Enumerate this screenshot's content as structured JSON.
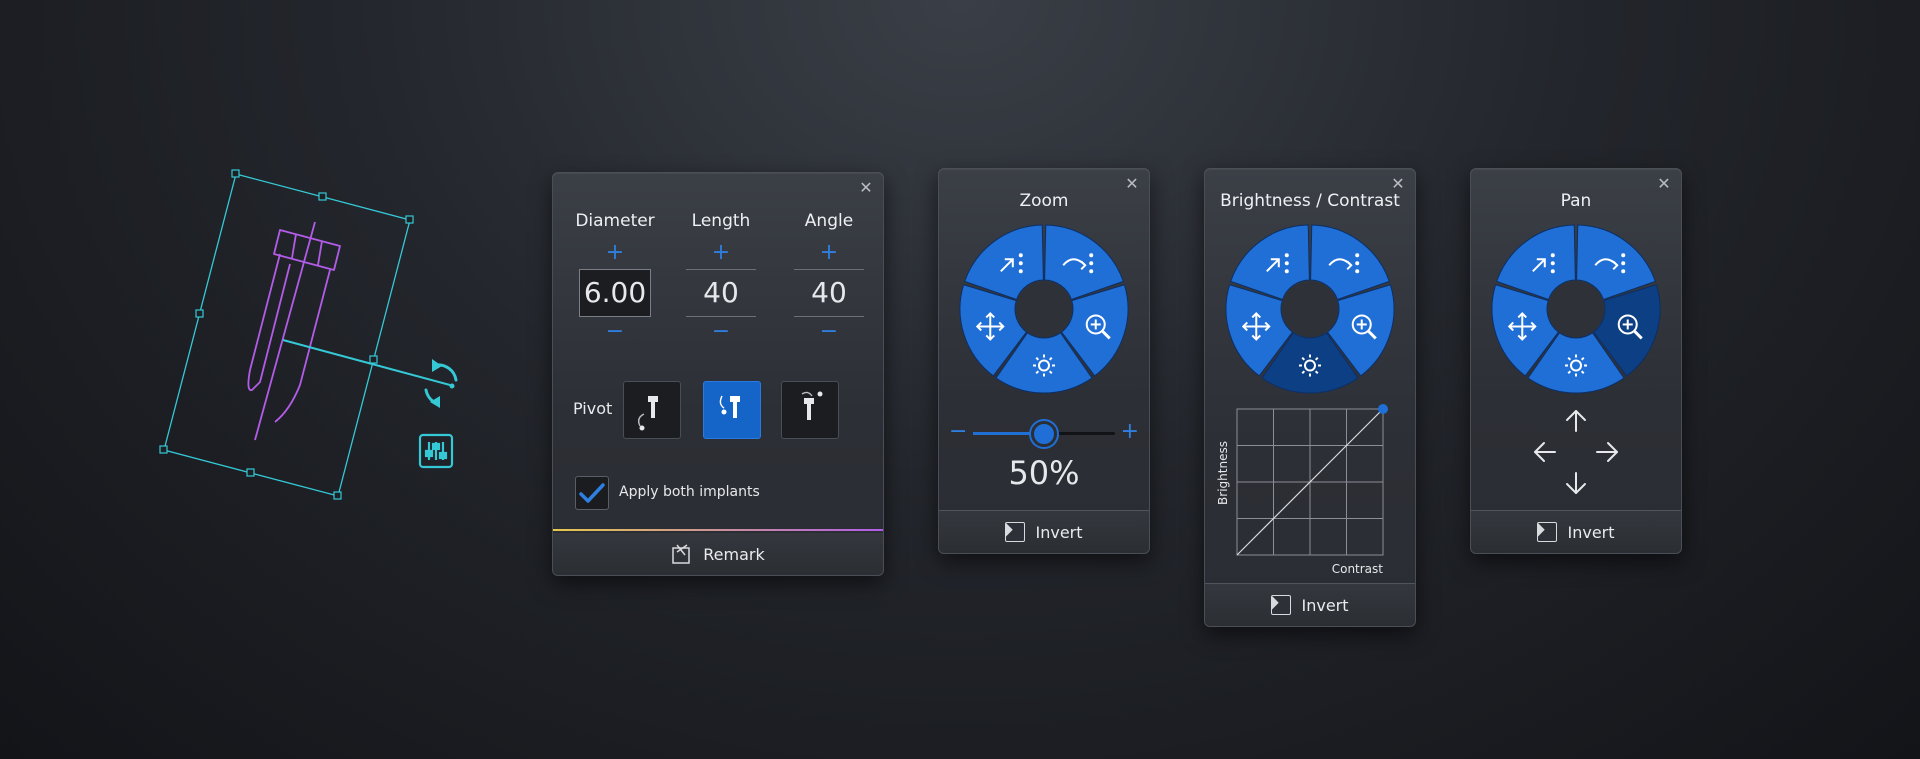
{
  "implant": {
    "columns": [
      {
        "label": "Diameter",
        "value": "6.00",
        "plus": "+",
        "minus": "−"
      },
      {
        "label": "Length",
        "value": "40",
        "plus": "+",
        "minus": "−"
      },
      {
        "label": "Angle",
        "value": "40",
        "plus": "+",
        "minus": "−"
      }
    ],
    "pivot_label": "Pivot",
    "apply_label": "Apply both implants",
    "remark_label": "Remark"
  },
  "zoom": {
    "title": "Zoom",
    "minus": "−",
    "plus": "+",
    "value_text": "50%",
    "slider_fraction": 0.5,
    "invert_label": "Invert"
  },
  "brightness": {
    "title": "Brightness / Contrast",
    "xlabel": "Contrast",
    "ylabel": "Brightness",
    "invert_label": "Invert"
  },
  "pan": {
    "title": "Pan",
    "invert_label": "Invert"
  },
  "colors": {
    "accent_blue": "#1f6fd6",
    "selected_blue": "#0d3f85",
    "implant_purple": "#b25ce8",
    "handle_cyan": "#35c9d6"
  }
}
